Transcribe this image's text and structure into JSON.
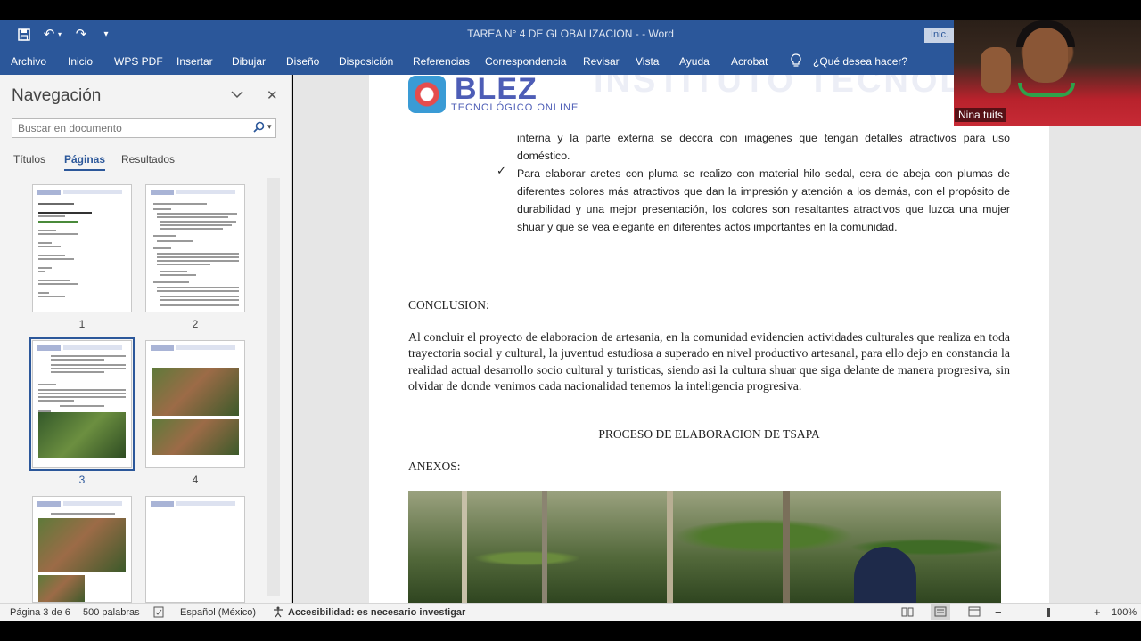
{
  "window": {
    "title": "TAREA N° 4 DE GLOBALIZACION -  -  Word",
    "signin": "Inic."
  },
  "ribbon": {
    "tabs": [
      "Archivo",
      "Inicio",
      "WPS PDF",
      "Insertar",
      "Dibujar",
      "Diseño",
      "Disposición",
      "Referencias",
      "Correspondencia",
      "Revisar",
      "Vista",
      "Ayuda",
      "Acrobat"
    ],
    "tell_me": "¿Qué desea hacer?"
  },
  "navigation": {
    "title": "Navegación",
    "search_placeholder": "Buscar en documento",
    "tabs": [
      "Títulos",
      "Páginas",
      "Resultados"
    ],
    "active_tab": "Páginas",
    "pages": [
      "1",
      "2",
      "3",
      "4"
    ],
    "selected_page": "3"
  },
  "document": {
    "logo_brand": "BLEZ",
    "logo_sub": "TECNOLÓGICO ONLINE",
    "watermark": "INSTITUTO TECNOLÓGICO",
    "bullet1_tail": "interna y la parte externa se decora con imágenes que tengan detalles atractivos para uso doméstico.",
    "bullet2": "Para elaborar aretes con pluma se realizo con material hilo sedal, cera de abeja con plumas de diferentes colores más atractivos que dan la impresión y atención a los demás, con el propósito de durabilidad y una mejor presentación, los colores son resaltantes atractivos que luzca una mujer shuar y que se vea elegante en diferentes actos importantes en la comunidad.",
    "conclusion_heading": "CONCLUSION:",
    "conclusion_text": "Al concluir el proyecto de elaboracion de artesania, en la comunidad evidencien actividades culturales que realiza en toda trayectoria social y cultural, la juventud estudiosa a superado en nivel productivo artesanal, para ello dejo en constancia la realidad actual desarrollo socio cultural y turisticas, siendo asi la cultura shuar que siga delante de manera progresiva,  sin olvidar de donde venimos cada nacionalidad tenemos la inteligencia progresiva.",
    "process_title": "PROCESO DE ELABORACION DE TSAPA",
    "annex_heading": "ANEXOS:"
  },
  "status_bar": {
    "page": "Página 3 de 6",
    "words": "500 palabras",
    "language": "Español (México)",
    "accessibility": "Accesibilidad: es necesario investigar",
    "zoom": "100%"
  },
  "webcam": {
    "name": "Nina tuits"
  },
  "colors": {
    "accent": "#2b579a",
    "brand": "#4d5db6"
  }
}
